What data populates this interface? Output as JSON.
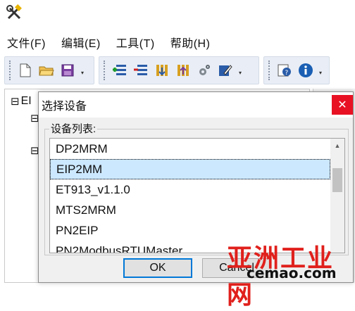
{
  "menubar": {
    "items": [
      "文件(F)",
      "编辑(E)",
      "工具(T)",
      "帮助(H)"
    ]
  },
  "toolbar": {
    "group1_icons": [
      "new-file-icon",
      "open-folder-icon",
      "save-icon"
    ],
    "group2_icons": [
      "add-device-icon",
      "remove-device-icon",
      "download-icon",
      "upload-icon",
      "settings-gear-icon",
      "edit-icon"
    ],
    "group3_icons": [
      "help-icon",
      "info-icon"
    ]
  },
  "tree": {
    "root_label": "EI",
    "expander": "⊟"
  },
  "dialog": {
    "title": "选择设备",
    "close_glyph": "✕",
    "group_label": "设备列表:",
    "items": [
      "DP2MRM",
      "EIP2MM",
      "ET913_v1.1.0",
      "MTS2MRM",
      "PN2EIP",
      "PN2ModbusRTUMaster"
    ],
    "selected_index": 1,
    "ok_label": "OK",
    "cancel_label": "Cancel"
  },
  "watermark": {
    "cn": "亚洲工业网",
    "url": "cemao.com"
  },
  "colors": {
    "close_red": "#e81123",
    "selection": "#cce8ff",
    "accent": "#0078d7",
    "watermark_red": "#e0201c"
  }
}
